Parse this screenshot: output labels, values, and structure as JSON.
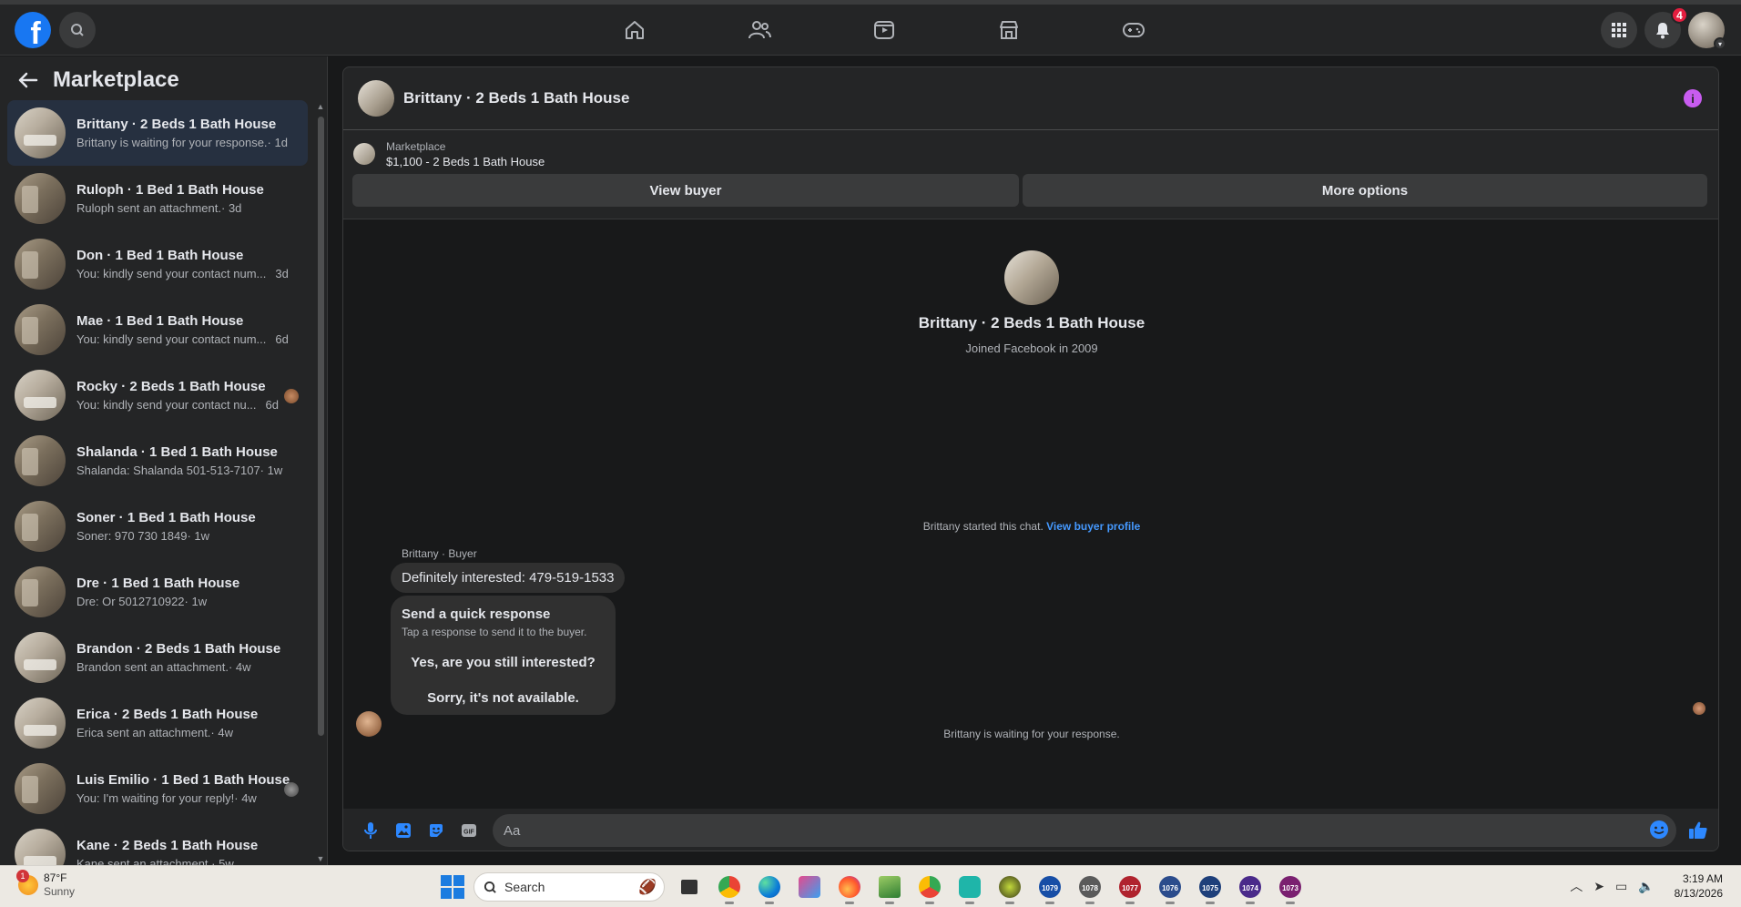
{
  "topbar": {
    "logo": "f",
    "notifications_badge": "4",
    "nav_icons": [
      "home-icon",
      "friends-icon",
      "video-icon",
      "marketplace-icon",
      "gaming-icon"
    ]
  },
  "sidebar": {
    "title": "Marketplace",
    "items": [
      {
        "name": "Brittany · 2 Beds 1 Bath House",
        "snippet": "Brittany is waiting for your response.",
        "time": "· 1d",
        "active": true
      },
      {
        "name": "Ruloph · 1 Bed 1 Bath House",
        "snippet": "Ruloph sent an attachment.",
        "time": "· 3d"
      },
      {
        "name": "Don · 1 Bed 1 Bath House",
        "snippet": "You: kindly send your contact num...",
        "time": "3d"
      },
      {
        "name": "Mae · 1 Bed 1 Bath House",
        "snippet": "You: kindly send your contact num...",
        "time": "6d"
      },
      {
        "name": "Rocky · 2 Beds 1 Bath House",
        "snippet": "You: kindly send your contact nu...",
        "time": "6d"
      },
      {
        "name": "Shalanda · 1 Bed 1 Bath House",
        "snippet": "Shalanda: Shalanda 501-513-7107",
        "time": "· 1w"
      },
      {
        "name": "Soner · 1 Bed 1 Bath House",
        "snippet": "Soner: 970 730 1849",
        "time": "· 1w"
      },
      {
        "name": "Dre · 1 Bed 1 Bath House",
        "snippet": "Dre: Or 5012710922",
        "time": "· 1w"
      },
      {
        "name": "Brandon · 2 Beds 1 Bath House",
        "snippet": "Brandon sent an attachment.",
        "time": "· 4w"
      },
      {
        "name": "Erica · 2 Beds 1 Bath House",
        "snippet": "Erica sent an attachment.",
        "time": "· 4w"
      },
      {
        "name": "Luis Emilio · 1 Bed 1 Bath House",
        "snippet": "You: I'm waiting for your reply!",
        "time": "· 4w"
      },
      {
        "name": "Kane · 2 Beds 1 Bath House",
        "snippet": "Kane sent an attachment.",
        "time": "· 5w"
      }
    ]
  },
  "chat": {
    "title": "Brittany · 2 Beds 1 Bath House",
    "listing_category": "Marketplace",
    "listing_price": "$1,100 - 2 Beds 1 Bath House",
    "view_buyer_label": "View buyer",
    "more_options_label": "More options",
    "profile_name": "Brittany · 2 Beds 1 Bath House",
    "profile_joined": "Joined Facebook in 2009",
    "started_text": "Brittany started this chat.",
    "started_link": "View buyer profile",
    "sender_label": "Brittany · Buyer",
    "message": "Definitely interested: 479-519-1533",
    "quick_title": "Send a quick response",
    "quick_sub": "Tap a response to send it to the buyer.",
    "quick_opt_1": "Yes, are you still interested?",
    "quick_opt_2": "Sorry, it's not available.",
    "waiting_text": "Brittany is waiting for your response.",
    "composer_placeholder": "Aa"
  },
  "taskbar": {
    "temp": "87°F",
    "condition": "Sunny",
    "weather_badge": "1",
    "search_label": "Search",
    "time": "3:19 AM",
    "date": "8/13/2026",
    "app_numbers": [
      "1079",
      "1078",
      "1077",
      "1076",
      "1075",
      "1074",
      "1073"
    ]
  },
  "colors": {
    "accent": "#1877f2",
    "link": "#4599ff",
    "badge": "#e41e3f",
    "info": "#c85cf0"
  }
}
